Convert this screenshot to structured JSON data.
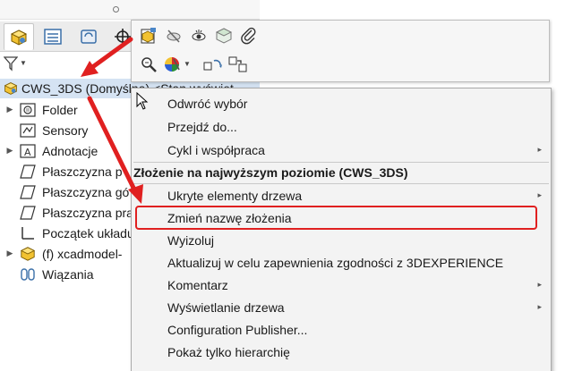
{
  "tree": {
    "root_label": "CWS_3DS (Domyślna) <Stan wyświet",
    "items": [
      {
        "label": "Folder",
        "icon": "folder-icon",
        "expandable": true
      },
      {
        "label": "Sensory",
        "icon": "sensor-icon",
        "expandable": false
      },
      {
        "label": "Adnotacje",
        "icon": "annotation-icon",
        "expandable": true
      },
      {
        "label": "Płaszczyzna p",
        "icon": "plane-icon",
        "expandable": false
      },
      {
        "label": "Płaszczyzna gó",
        "icon": "plane-icon",
        "expandable": false
      },
      {
        "label": "Płaszczyzna pra",
        "icon": "plane-icon",
        "expandable": false
      },
      {
        "label": "Początek układu",
        "icon": "origin-icon",
        "expandable": false
      },
      {
        "label": "(f) xcadmodel-",
        "icon": "part-icon",
        "expandable": true
      },
      {
        "label": "Wiązania",
        "icon": "mates-icon",
        "expandable": false
      }
    ]
  },
  "menu": {
    "top_items": [
      {
        "label": "Odwróć wybór"
      },
      {
        "label": "Przejdź do..."
      },
      {
        "label": "Cykl i współpraca",
        "submenu": true
      }
    ],
    "section_title": "Złożenie na najwyższym poziomie (CWS_3DS)",
    "items": [
      {
        "label": "Ukryte elementy drzewa",
        "submenu": true
      },
      {
        "label": "Zmień nazwę złożenia",
        "highlighted": true
      },
      {
        "label": "Wyizoluj"
      },
      {
        "label": "Aktualizuj w celu zapewnienia zgodności z 3DEXPERIENCE"
      },
      {
        "label": "Komentarz",
        "submenu": true
      },
      {
        "label": "Wyświetlanie drzewa",
        "submenu": true
      },
      {
        "label": "Configuration Publisher..."
      },
      {
        "label": "Pokaż tylko hierarchię"
      }
    ],
    "submenu_arrow": "▸"
  },
  "colors": {
    "annotation_red": "#e02020",
    "selection_blue": "#d5e3f3",
    "menu_bg": "#f3f3f3"
  }
}
